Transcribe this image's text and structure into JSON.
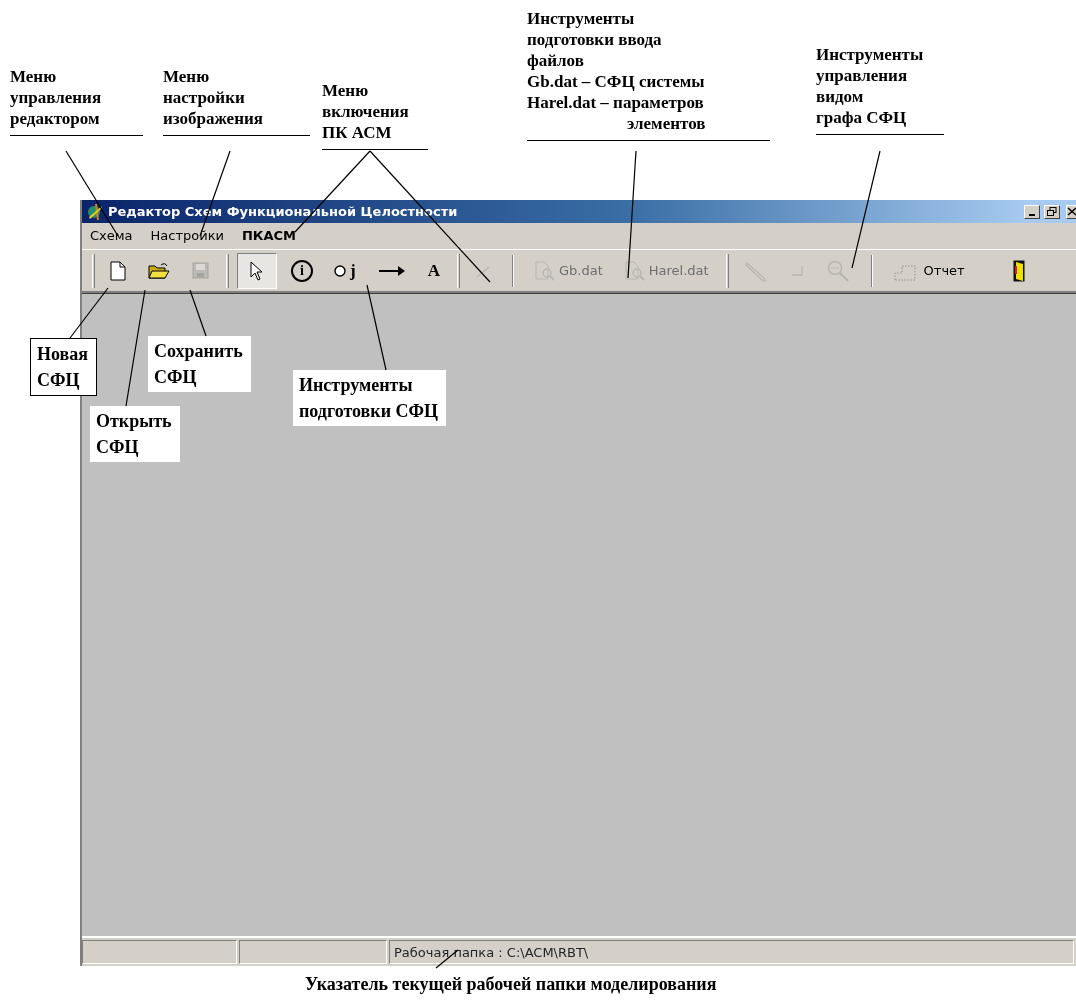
{
  "annotations": [
    {
      "lines": [
        "Меню",
        "управления",
        "редактором"
      ]
    },
    {
      "lines": [
        "Меню",
        "настройки",
        "изображения"
      ]
    },
    {
      "lines": [
        "Меню",
        "включения",
        "ПК АСМ"
      ]
    },
    {
      "lines": [
        "Инструменты",
        "подготовки ввода",
        "файлов",
        "Gb.dat – СФЦ системы",
        "Harel.dat –  параметров",
        "элементов"
      ]
    },
    {
      "lines": [
        "Инструменты",
        "управления",
        "видом",
        "графа СФЦ"
      ]
    }
  ],
  "window": {
    "title": "Редактор Схем Функциональной Целостности"
  },
  "menu": [
    {
      "label": "Схема",
      "bold": false
    },
    {
      "label": "Настройки",
      "bold": false
    },
    {
      "label": "ПКАСМ",
      "bold": true
    }
  ],
  "toolbar": [
    {
      "kind": "grip"
    },
    {
      "kind": "new",
      "disabled": false,
      "pressed": false
    },
    {
      "kind": "open",
      "disabled": false,
      "pressed": false
    },
    {
      "kind": "save",
      "disabled": true,
      "pressed": false
    },
    {
      "kind": "grip"
    },
    {
      "kind": "pointer",
      "disabled": false,
      "pressed": true
    },
    {
      "kind": "info",
      "text": "i",
      "disabled": false,
      "pressed": false
    },
    {
      "kind": "node",
      "text": "j",
      "disabled": false,
      "pressed": false
    },
    {
      "kind": "arrow",
      "disabled": false,
      "pressed": false
    },
    {
      "kind": "text",
      "text": "A",
      "disabled": false,
      "pressed": false
    },
    {
      "kind": "grip"
    },
    {
      "kind": "line",
      "disabled": true,
      "pressed": false
    },
    {
      "kind": "separator"
    },
    {
      "kind": "file",
      "text": "Gb.dat",
      "disabled": true,
      "pressed": false
    },
    {
      "kind": "file",
      "text": "Harel.dat",
      "disabled": true,
      "pressed": false
    },
    {
      "kind": "grip"
    },
    {
      "kind": "pencil",
      "disabled": true,
      "pressed": false
    },
    {
      "kind": "corner",
      "disabled": true,
      "pressed": false
    },
    {
      "kind": "zoom",
      "disabled": true,
      "pressed": false
    },
    {
      "kind": "separator"
    },
    {
      "kind": "report",
      "text": "Отчет",
      "disabled": false,
      "pressed": false
    },
    {
      "kind": "exit",
      "disabled": false,
      "pressed": false
    }
  ],
  "callouts": [
    {
      "lines": [
        "Новая",
        "СФЦ"
      ],
      "bordered": true
    },
    {
      "lines": [
        "Сохранить",
        "СФЦ"
      ],
      "bordered": false
    },
    {
      "lines": [
        "Открыть",
        "СФЦ"
      ],
      "bordered": false
    },
    {
      "lines": [
        "Инструменты",
        "подготовки СФЦ"
      ],
      "bordered": false
    }
  ],
  "status_bar": {
    "panels": [
      {
        "kind": "empty"
      },
      {
        "kind": "empty"
      },
      {
        "kind": "text",
        "text": "Рабочая папка : C:\\ACM\\RBT\\"
      }
    ]
  },
  "caption": "Указатель текущей рабочей папки моделирования"
}
